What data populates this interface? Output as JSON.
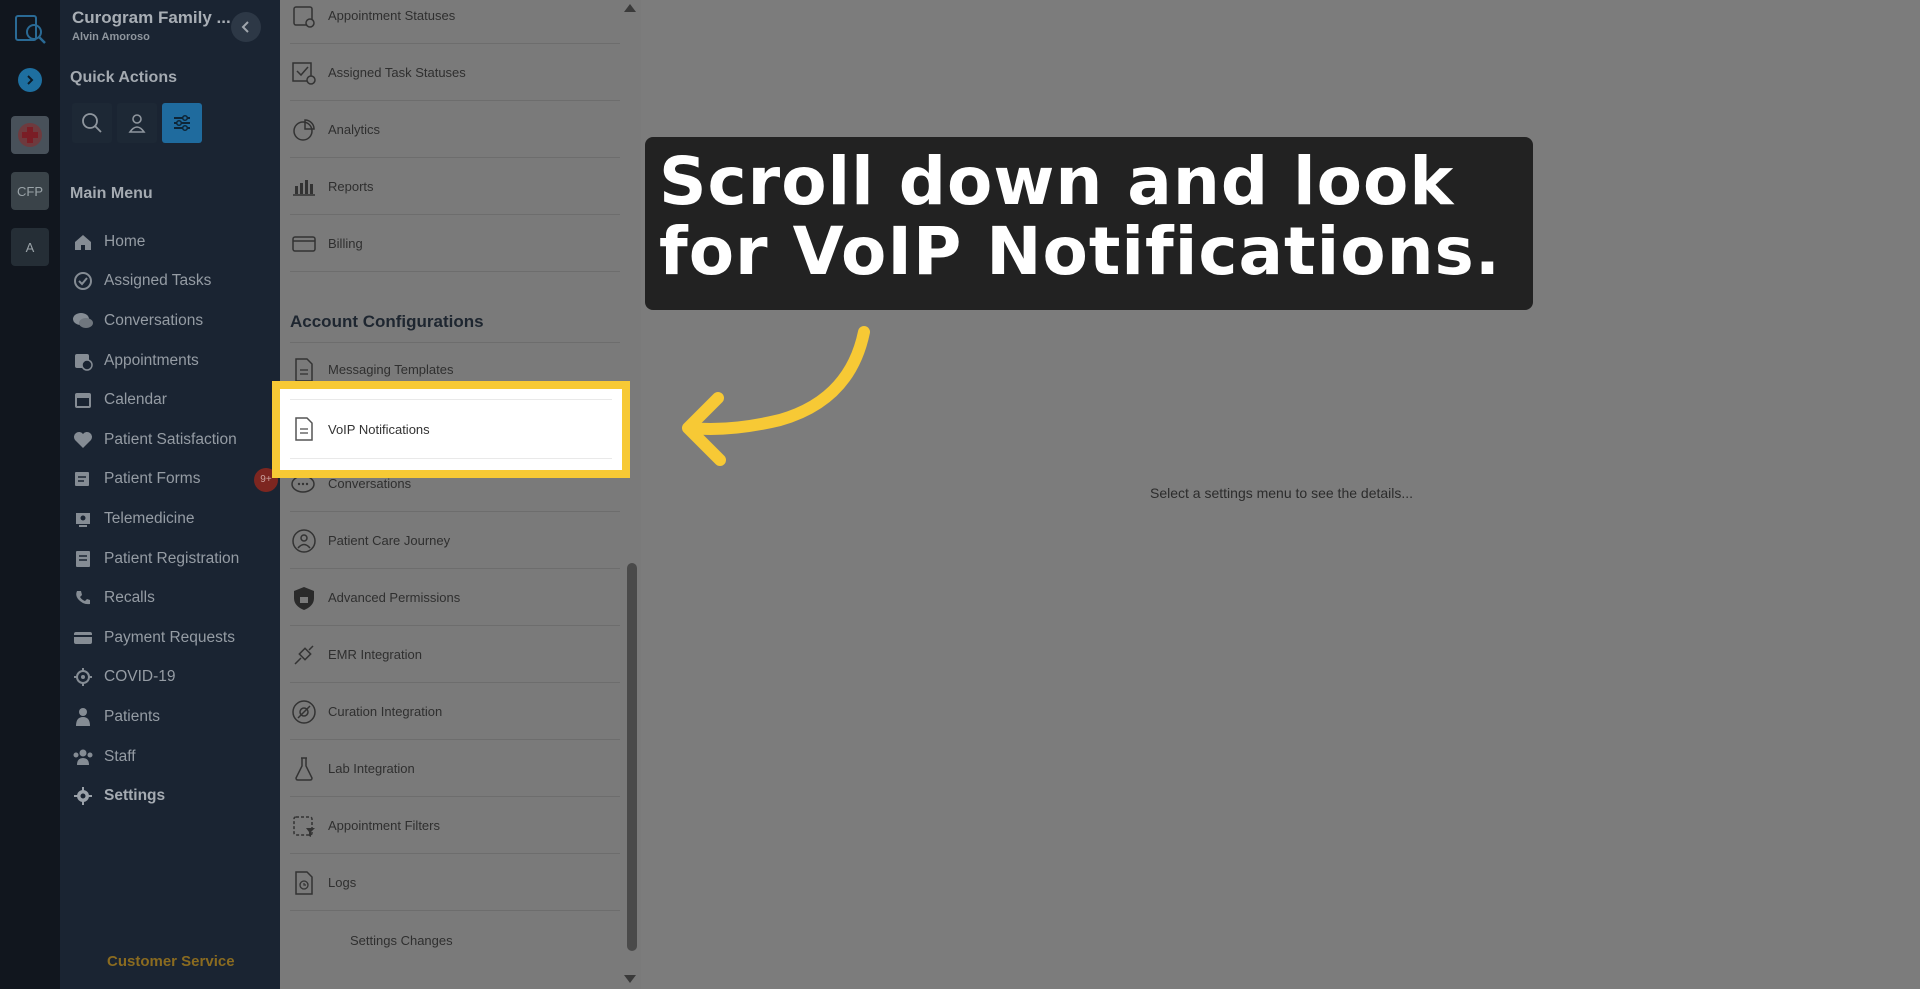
{
  "org": {
    "name": "Curogram Family ...",
    "user": "Alvin Amoroso",
    "rail_org_label": "CFP",
    "rail_org2_label": "A"
  },
  "sidebar": {
    "quick_actions_title": "Quick Actions",
    "main_menu_title": "Main Menu",
    "items": [
      {
        "label": "Home",
        "icon": "home-icon"
      },
      {
        "label": "Assigned Tasks",
        "icon": "check-circle-icon"
      },
      {
        "label": "Conversations",
        "icon": "chat-icon"
      },
      {
        "label": "Appointments",
        "icon": "calendar-clock-icon"
      },
      {
        "label": "Calendar",
        "icon": "calendar-icon"
      },
      {
        "label": "Patient Satisfaction",
        "icon": "heart-icon"
      },
      {
        "label": "Patient Forms",
        "icon": "forms-icon",
        "badge": "9+"
      },
      {
        "label": "Telemedicine",
        "icon": "video-icon"
      },
      {
        "label": "Patient Registration",
        "icon": "registration-icon"
      },
      {
        "label": "Recalls",
        "icon": "phone-recall-icon"
      },
      {
        "label": "Payment Requests",
        "icon": "credit-card-icon"
      },
      {
        "label": "COVID-19",
        "icon": "virus-icon"
      },
      {
        "label": "Patients",
        "icon": "user-icon"
      },
      {
        "label": "Staff",
        "icon": "users-icon"
      },
      {
        "label": "Settings",
        "icon": "gear-icon"
      }
    ],
    "customer_service": "Customer Service"
  },
  "settings_list": {
    "top_items": [
      "Appointment Statuses",
      "Assigned Task Statuses",
      "Analytics",
      "Reports",
      "Billing"
    ],
    "account_configurations_title": "Account Configurations",
    "account_items": [
      "Messaging Templates",
      "VoIP Notifications",
      "Conversations",
      "Patient Care Journey",
      "Advanced Permissions",
      "EMR Integration",
      "Curation Integration",
      "Lab Integration",
      "Appointment Filters",
      "Logs"
    ],
    "settings_changes": "Settings Changes"
  },
  "main": {
    "empty_message": "Select a settings menu to see the details..."
  },
  "callout": {
    "text": "Scroll down and look for VoIP Notifications."
  },
  "colors": {
    "highlight": "#f7c935",
    "callout_bg": "#222222",
    "sidebar_bg": "#1a2432",
    "accent": "#1f6b9e"
  }
}
